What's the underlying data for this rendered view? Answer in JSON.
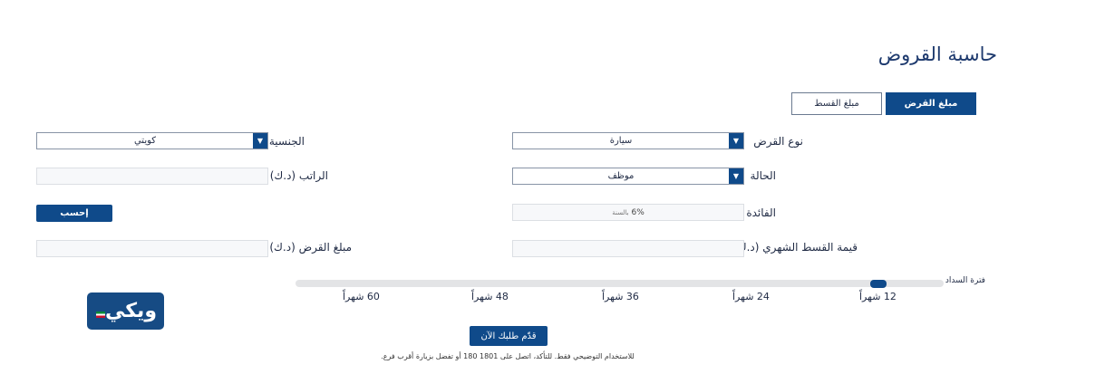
{
  "title": "حاسبة القروض",
  "tabs": {
    "loan_amount": "مبلغ القرض",
    "installment_amount": "مبلغ القسط"
  },
  "form": {
    "loan_type_label": "نوع القرض",
    "loan_type_value": "سيارة",
    "nationality_label": "الجنسية",
    "nationality_value": "كويتي",
    "status_label": "الحالة",
    "status_value": "موظف",
    "salary_label": "الراتب (د.ك)",
    "interest_label": "الفائدة",
    "interest_value": "6%",
    "interest_unit": "بالسنة",
    "calculate_button": "إحسب",
    "monthly_installment_label": "قيمة القسط الشهري (د.ك)",
    "loan_amount_label": "مبلغ القرض (د.ك)"
  },
  "slider": {
    "label": "فترة السداد",
    "ticks": [
      "12 شهراً",
      "24 شهراً",
      "36 شهراً",
      "48 شهراً",
      "60 شهراً"
    ],
    "selected_index": 0
  },
  "logo_text": "ويكي",
  "apply_button": "قدّم طلبك الآن",
  "disclaimer": "للاستخدام التوضيحي فقط. للتأكد، اتصل على 1801 180 أو تفضل بزيارة أقرب فرع.",
  "partial_heading": "...",
  "colors": {
    "primary": "#0f4a8a",
    "title": "#1e3a6e"
  }
}
